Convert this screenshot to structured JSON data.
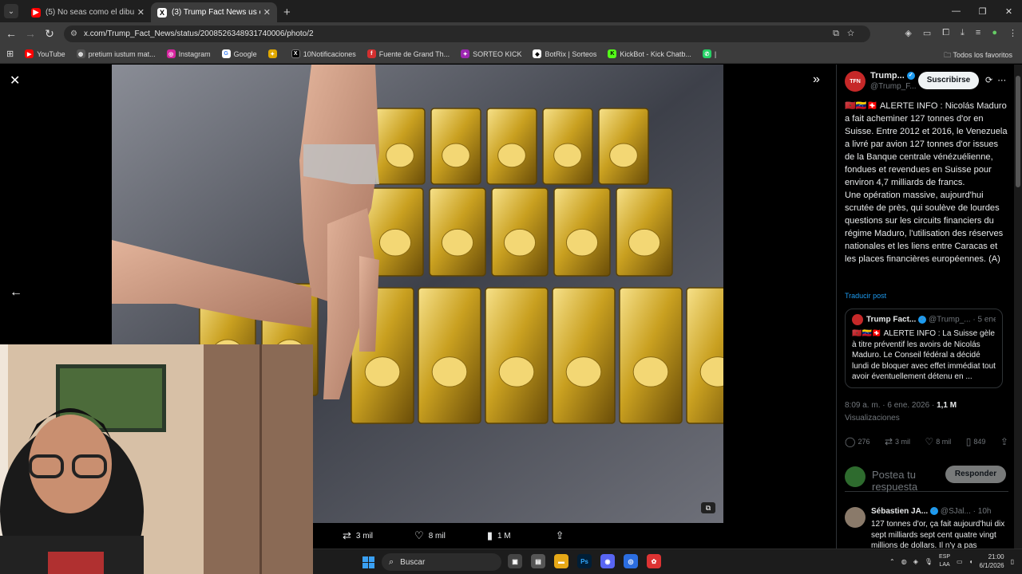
{
  "browser": {
    "tabs": [
      {
        "title": "(5) No seas como el dibujito y ...",
        "favicon": "youtube-icon",
        "color": "#ff0000"
      },
      {
        "title": "(3) Trump Fact News us en X: \"...",
        "favicon": "x-icon",
        "color": "#000000"
      }
    ],
    "new_tab": "+",
    "url": "x.com/Trump_Fact_News/status/2008526348931740006/photo/2",
    "bookmarks": [
      {
        "label": "YouTube",
        "icon": "youtube-icon",
        "color": "#ff0000"
      },
      {
        "label": "pretium iustum mat...",
        "icon": "globe-icon",
        "color": "#555555"
      },
      {
        "label": "Instagram",
        "icon": "instagram-icon",
        "color": "#d6249f"
      },
      {
        "label": "Google",
        "icon": "google-icon",
        "color": "#4285f4"
      },
      {
        "label": "",
        "icon": "pinwheel-icon",
        "color": "#e0a800"
      },
      {
        "label": "10Notificaciones",
        "icon": "x-icon",
        "color": "#000000"
      },
      {
        "label": "Fuente de Grand Th...",
        "icon": "font-icon",
        "color": "#d32f2f"
      },
      {
        "label": "SORTEO KICK",
        "icon": "kick-icon",
        "color": "#9c27b0"
      },
      {
        "label": "BotRix | Sorteos",
        "icon": "botrix-icon",
        "color": "#ffffff"
      },
      {
        "label": "KickBot - Kick Chatb...",
        "icon": "kickbot-icon",
        "color": "#53fc18"
      },
      {
        "label": "|",
        "icon": "whatsapp-icon",
        "color": "#25d366"
      }
    ],
    "all_favorites": "Todos los favoritos"
  },
  "viewer": {
    "actions": {
      "retweets": "3 mil",
      "likes": "8 mil",
      "views": "1 M"
    }
  },
  "post": {
    "author_name": "Trump...",
    "author_handle": "@Trump_F...",
    "avatar_label": "TFN",
    "subscribe_label": "Suscribirse",
    "text": "🇲🇦🇻🇪🇨🇭 ALERTE INFO : Nicolás Maduro a fait acheminer 127 tonnes d'or en Suisse. Entre 2012 et 2016, le Venezuela a livré par avion 127 tonnes d'or issues de la Banque centrale vénézuélienne, fondues et revendues en Suisse pour environ 4,7 milliards de francs.\nUne opération massive, aujourd'hui scrutée de près, qui soulève de lourdes questions sur les circuits financiers du régime Maduro, l'utilisation des réserves nationales et les liens entre Caracas et les places financières européennes. (A)",
    "translate_label": "Traducir post",
    "quote": {
      "author_name": "Trump Fact...",
      "author_handle": "@Trump_...",
      "date": "· 5 ene.",
      "text": "🇲🇦🇻🇪🇨🇭 ALERTE INFO : La Suisse gèle à titre préventif les avoirs de Nicolás Maduro. Le Conseil fédéral a décidé lundi de bloquer avec effet immédiat tout avoir éventuellement détenu en ..."
    },
    "timestamp": "8:09 a. m. · 6 ene. 2026 ·",
    "views_count": "1,1 M",
    "views_label": "Visualizaciones",
    "stats": {
      "replies": "276",
      "retweets": "3 mil",
      "likes": "8 mil",
      "bookmarks": "849"
    },
    "reply_placeholder": "Postea tu respuesta",
    "reply_button": "Responder",
    "comment": {
      "author_name": "Sébastien JA...",
      "author_handle": "@SJal...",
      "time": "· 10h",
      "text": "127 tonnes d'or, ça fait aujourd'hui dix sept milliards sept cent quatre vingt millions de dollars. Il n'y a pas"
    }
  },
  "taskbar": {
    "search_label": "Buscar",
    "lang_top": "ESP",
    "lang_bottom": "LAA",
    "time": "21:00",
    "date": "6/1/2026"
  }
}
